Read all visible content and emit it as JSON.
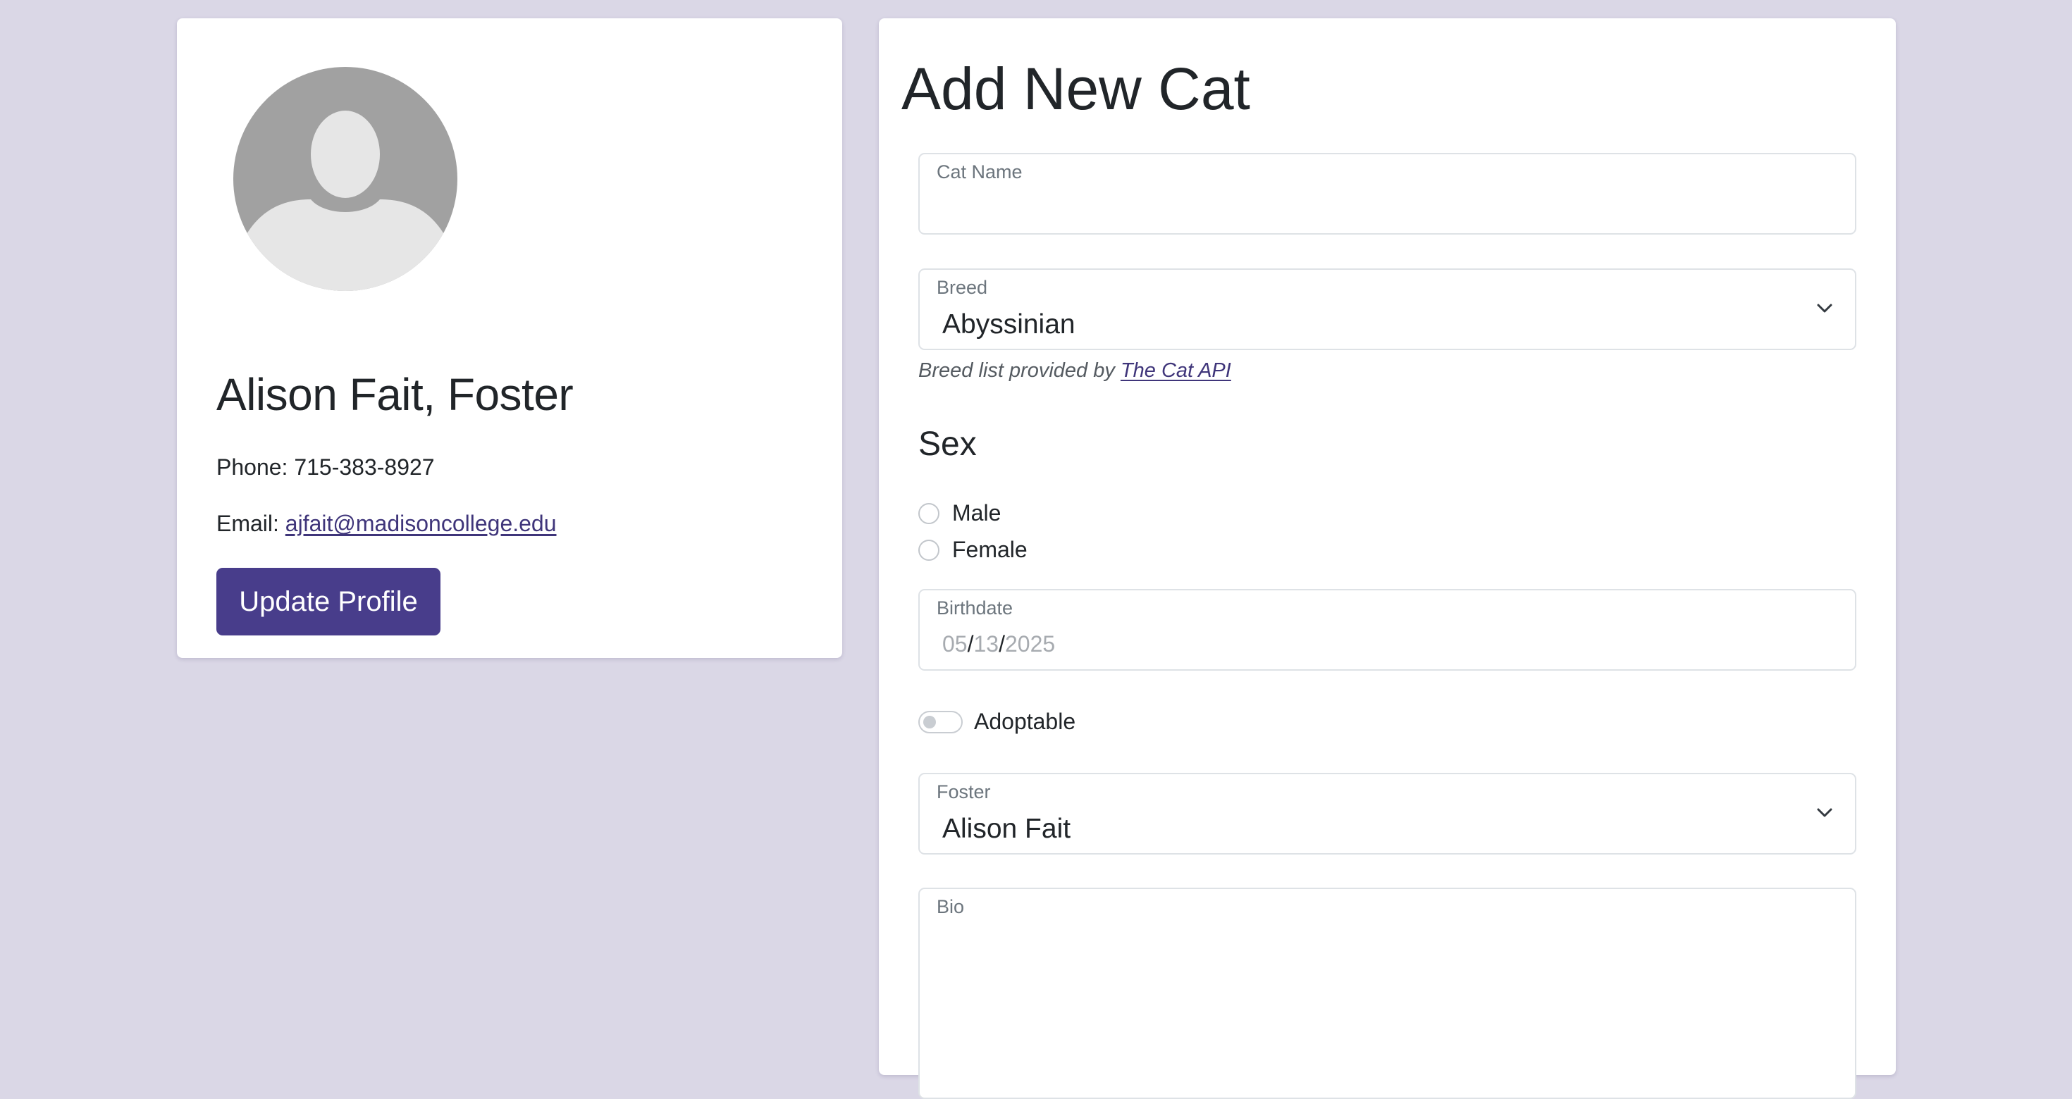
{
  "profile": {
    "name": "Alison Fait, Foster",
    "phone_label": "Phone:",
    "phone": "715-383-8927",
    "email_label": "Email:",
    "email": "ajfait@madisoncollege.edu",
    "update_button": "Update Profile",
    "avatar_icon": "user-silhouette-icon"
  },
  "form": {
    "title": "Add New Cat",
    "cat_name": {
      "label": "Cat Name",
      "value": ""
    },
    "breed": {
      "label": "Breed",
      "value": "Abyssinian",
      "helper_prefix": "Breed list provided by",
      "helper_link": "The Cat API"
    },
    "sex": {
      "heading": "Sex",
      "options": [
        "Male",
        "Female"
      ]
    },
    "birthdate": {
      "label": "Birthdate",
      "month": "05",
      "day": "13",
      "year": "2025",
      "separator": "/"
    },
    "adoptable": {
      "label": "Adoptable",
      "checked": false
    },
    "foster": {
      "label": "Foster",
      "value": "Alison Fait"
    },
    "bio": {
      "label": "Bio",
      "value": ""
    }
  },
  "colors": {
    "background": "#dad7e6",
    "primary": "#483d8b",
    "link": "#3f357a"
  }
}
